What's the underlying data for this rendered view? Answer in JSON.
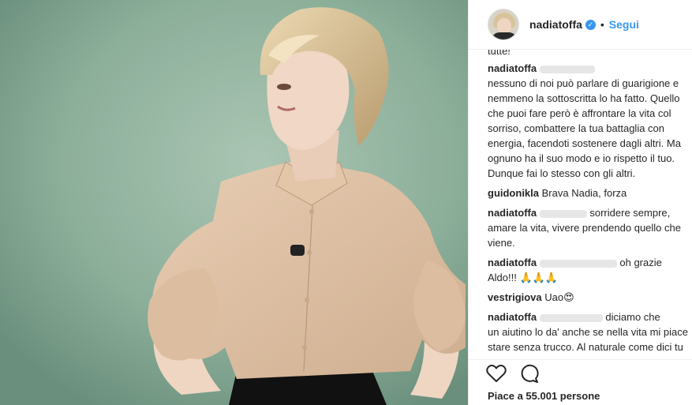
{
  "header": {
    "username": "nadiatoffa",
    "follow_label": "Segui",
    "separator": "•"
  },
  "comments": [
    {
      "id": "top-fragment",
      "user": "",
      "text": "tutte!"
    },
    {
      "id": "c1",
      "user": "nadiatoffa",
      "text": "nessuno di noi può parlare di guarigione e nemmeno la sottoscritta lo ha fatto. Quello che puoi fare però è affrontare la vita col sorriso, combattere la tua battaglia con energia, facendoti sostenere dagli altri. Ma ognuno ha il suo modo e io rispetto il tuo. Dunque fai lo stesso con gli altri."
    },
    {
      "id": "c2",
      "user": "guidonikla",
      "text": "Brava Nadia, forza"
    },
    {
      "id": "c3",
      "user": "nadiatoffa",
      "text_a": "sorridere sempre,",
      "text_b": "amare la vita, vivere prendendo quello che viene."
    },
    {
      "id": "c4",
      "user": "nadiatoffa",
      "text_a": "oh grazie",
      "text_b": "Aldo!!! 🙏🙏🙏"
    },
    {
      "id": "c5",
      "user": "vestrigiova",
      "text": "Uao😍"
    },
    {
      "id": "c6",
      "user": "nadiatoffa",
      "text_a": "diciamo che",
      "text_b": "un aiutino lo da' anche se nella vita mi piace stare senza trucco. Al naturale come dici tu"
    }
  ],
  "footer": {
    "likes_text": "Piace a 55.001 persone",
    "like_icon": "heart-icon",
    "comment_icon": "comment-icon"
  },
  "colors": {
    "accent": "#3897f0",
    "text": "#262626",
    "background_photo": "#8fb09c"
  }
}
